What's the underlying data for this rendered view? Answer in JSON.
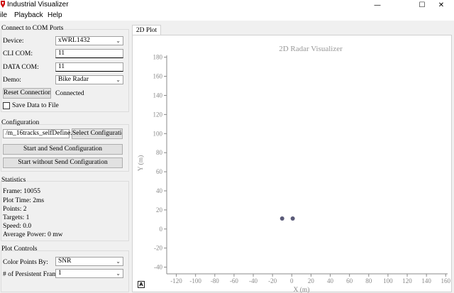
{
  "window": {
    "title": "Industrial Visualizer"
  },
  "menu": [
    "ile",
    "Playback",
    "Help"
  ],
  "com_ports": {
    "title": "Connect to COM Ports",
    "device_label": "Device:",
    "device_value": "xWRL1432",
    "cli_label": "CLI COM:",
    "cli_value": "11",
    "data_label": "DATA COM:",
    "data_value": "11",
    "demo_label": "Demo:",
    "demo_value": "Bike Radar",
    "reset_label": "Reset Connection",
    "status": "Connected",
    "save_label": "Save Data to File"
  },
  "configuration": {
    "title": "Configuration",
    "file": "/m_16tracks_selfDefine.cfg",
    "select_label": "Select Configuration",
    "start_send_label": "Start and Send Configuration",
    "start_nosend_label": "Start without Send Configuration"
  },
  "statistics": {
    "title": "Statistics",
    "frame": "Frame: 10055",
    "plot_time": "Plot Time: 2ms",
    "points": "Points: 2",
    "targets": "Targets: 1",
    "speed": "Speed: 0.0",
    "avg_power": "Average Power: 0 mw"
  },
  "plot_controls": {
    "title": "Plot Controls",
    "color_label": "Color Points By:",
    "color_value": "SNR",
    "persist_label": "# of Persistent Frames",
    "persist_value": "1"
  },
  "tabs": [
    "2D Plot"
  ],
  "colors": {
    "point": "#5a5a78",
    "axis": "#8a8a8a",
    "tick_text": "#888888"
  },
  "chart_data": {
    "type": "scatter",
    "title": "2D Radar Visualizer",
    "xlabel": "X (m)",
    "ylabel": "Y (m)",
    "xlim": [
      -130,
      162
    ],
    "ylim": [
      -47,
      182
    ],
    "xticks": [
      -120,
      -100,
      -80,
      -60,
      -40,
      -20,
      0,
      20,
      40,
      60,
      80,
      100,
      120,
      140,
      160
    ],
    "yticks": [
      -40,
      -20,
      0,
      20,
      40,
      60,
      80,
      100,
      120,
      140,
      160,
      180
    ],
    "grid": false,
    "points": [
      {
        "x": -10,
        "y": 11
      },
      {
        "x": 1,
        "y": 11
      }
    ]
  }
}
